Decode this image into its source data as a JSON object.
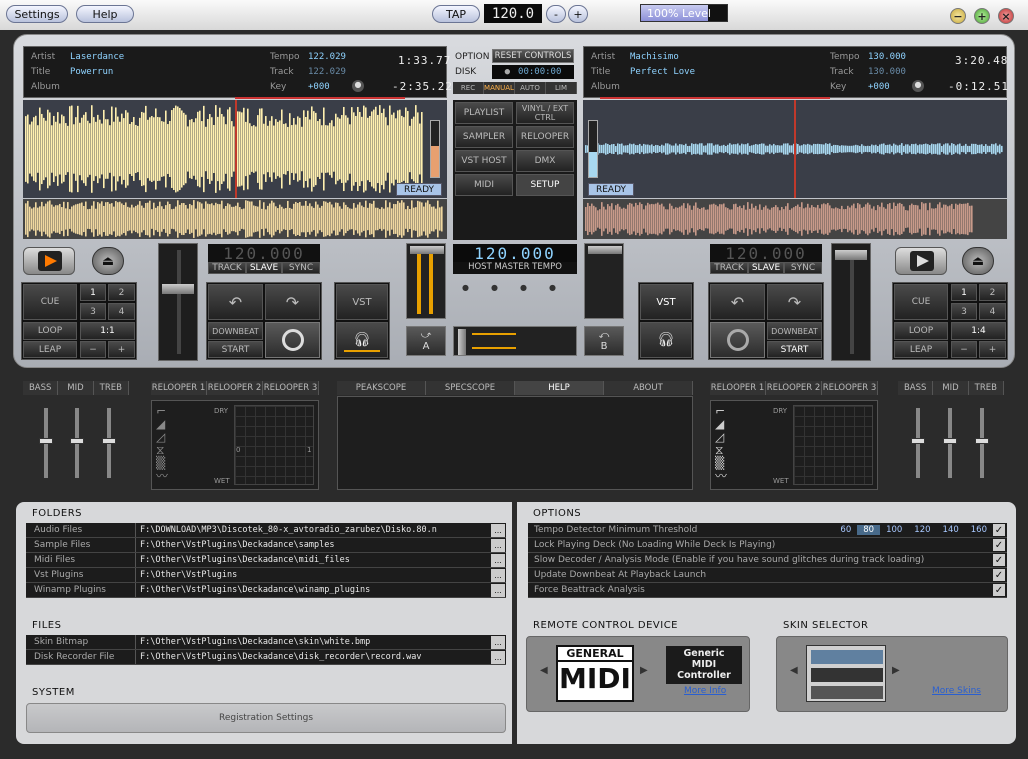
{
  "topbar": {
    "settings": "Settings",
    "help": "Help",
    "tap": "TAP",
    "bpm": "120.0",
    "minus": "-",
    "plus": "+",
    "level": "100% Level"
  },
  "center": {
    "option": "OPTION",
    "disk": "DISK",
    "reset": "RESET CONTROLS",
    "disk_time": "00:00:00",
    "modes": [
      "REC",
      "MANUAL",
      "AUTO",
      "LIM"
    ],
    "menu": [
      "PLAYLIST",
      "VINYL / EXT CTRL",
      "SAMPLER",
      "RELOOPER",
      "VST HOST",
      "DMX",
      "MIDI",
      "SETUP"
    ],
    "master_bpm": "120.000",
    "master_label": "HOST MASTER TEMPO",
    "xfade_a": "A",
    "xfade_b": "B"
  },
  "deck_a": {
    "artist_l": "Artist",
    "artist": "Laserdance",
    "title_l": "Title",
    "title": "Powerrun",
    "album_l": "Album",
    "tempo_l": "Tempo",
    "tempo": "122.029",
    "track_l": "Track",
    "track": "122.029",
    "key_l": "Key",
    "key": "+000",
    "time1": "1:33.77",
    "time2": "-2:35.22",
    "ready": "READY",
    "bpm": "120.000",
    "sync": [
      "TRACK",
      "SLAVE",
      "SYNC"
    ],
    "cue": "CUE",
    "loop": "LOOP",
    "leap": "LEAP",
    "cue_nums": [
      "1",
      "2",
      "3",
      "4"
    ],
    "loop_val": "1:1",
    "downbeat": "DOWNBEAT",
    "start": "START",
    "vst": "VST"
  },
  "deck_b": {
    "artist_l": "Artist",
    "artist": "Machisimo",
    "title_l": "Title",
    "title": "Perfect Love",
    "album_l": "Album",
    "tempo_l": "Tempo",
    "tempo": "130.000",
    "track_l": "Track",
    "track": "130.000",
    "key_l": "Key",
    "key": "+000",
    "time1": "3:20.48",
    "time2": "-0:12.51",
    "ready": "READY",
    "bpm": "120.000",
    "sync": [
      "TRACK",
      "SLAVE",
      "SYNC"
    ],
    "cue": "CUE",
    "loop": "LOOP",
    "leap": "LEAP",
    "cue_nums": [
      "1",
      "2",
      "3",
      "4"
    ],
    "loop_val": "1:4",
    "downbeat": "DOWNBEAT",
    "start": "START",
    "vst": "VST"
  },
  "eq": [
    "BASS",
    "MID",
    "TREB"
  ],
  "relooper": [
    "RELOOPER 1",
    "RELOOPER 2",
    "RELOOPER 3"
  ],
  "rl_labels": {
    "dry": "DRY",
    "wet": "WET",
    "zero": "0",
    "one": "1"
  },
  "center_tabs": [
    "PEAKSCOPE",
    "SPECSCOPE",
    "HELP",
    "ABOUT"
  ],
  "folders": {
    "title": "FOLDERS",
    "rows": [
      {
        "label": "Audio Files",
        "path": "F:\\DOWNLOAD\\MP3\\Discotek_80-x_avtoradio_zarubez\\Disko.80.n"
      },
      {
        "label": "Sample Files",
        "path": "F:\\Other\\VstPlugins\\Deckadance\\samples"
      },
      {
        "label": "Midi Files",
        "path": "F:\\Other\\VstPlugins\\Deckadance\\midi_files"
      },
      {
        "label": "Vst Plugins",
        "path": "F:\\Other\\VstPlugins"
      },
      {
        "label": "Winamp Plugins",
        "path": "F:\\Other\\VstPlugins\\Deckadance\\winamp_plugins"
      }
    ]
  },
  "files": {
    "title": "FILES",
    "rows": [
      {
        "label": "Skin Bitmap",
        "path": "F:\\Other\\VstPlugins\\Deckadance\\skin\\white.bmp"
      },
      {
        "label": "Disk Recorder File",
        "path": "F:\\Other\\VstPlugins\\Deckadance\\disk_recorder\\record.wav"
      }
    ]
  },
  "system": {
    "title": "SYSTEM",
    "button": "Registration Settings"
  },
  "options": {
    "title": "OPTIONS",
    "threshold": "Tempo Detector Minimum Threshold",
    "values": [
      "60",
      "80",
      "100",
      "120",
      "140",
      "160"
    ],
    "selected": "80",
    "items": [
      "Lock Playing Deck (No Loading While Deck Is Playing)",
      "Slow Decoder / Analysis Mode (Enable if you have sound glitches during track loading)",
      "Update Downbeat At Playback Launch",
      "Force Beattrack Analysis"
    ]
  },
  "remote": {
    "title": "REMOTE CONTROL DEVICE",
    "logo_top": "GENERAL",
    "logo_bottom": "MIDI",
    "device": "Generic MIDI Controller",
    "more": "More Info"
  },
  "skin": {
    "title": "SKIN SELECTOR",
    "more": "More Skins"
  },
  "colors": {
    "wave_a": "#fff0b0",
    "wave_b": "#a8d8f0",
    "accent": "#ff8c00"
  }
}
